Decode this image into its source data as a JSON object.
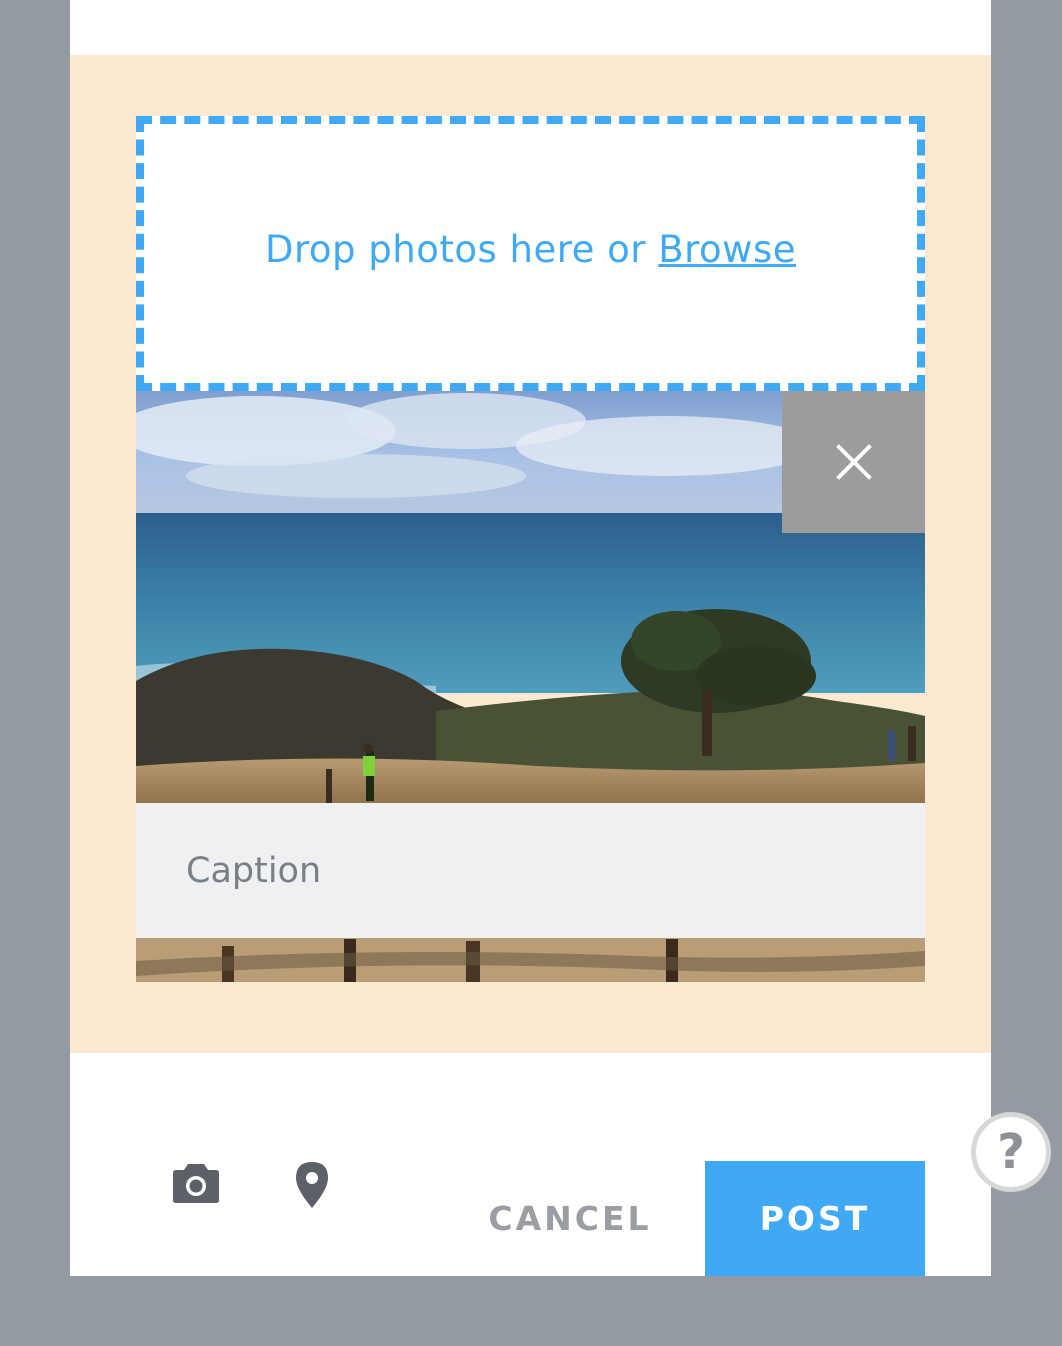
{
  "dropzone": {
    "text": "Drop photos here or ",
    "browse_label": "Browse"
  },
  "photo": {
    "caption_placeholder": "Caption",
    "caption_value": ""
  },
  "footer": {
    "camera_icon": "camera-icon",
    "location_icon": "map-pin-icon",
    "cancel_label": "CANCEL",
    "post_label": "POST"
  },
  "help": {
    "label": "?"
  },
  "colors": {
    "accent": "#3fa9f5",
    "upload_bg": "#fde9d1",
    "page_bg": "#939aa2",
    "remove_bg": "#9b9c9e",
    "caption_bg": "#eff0f2"
  }
}
